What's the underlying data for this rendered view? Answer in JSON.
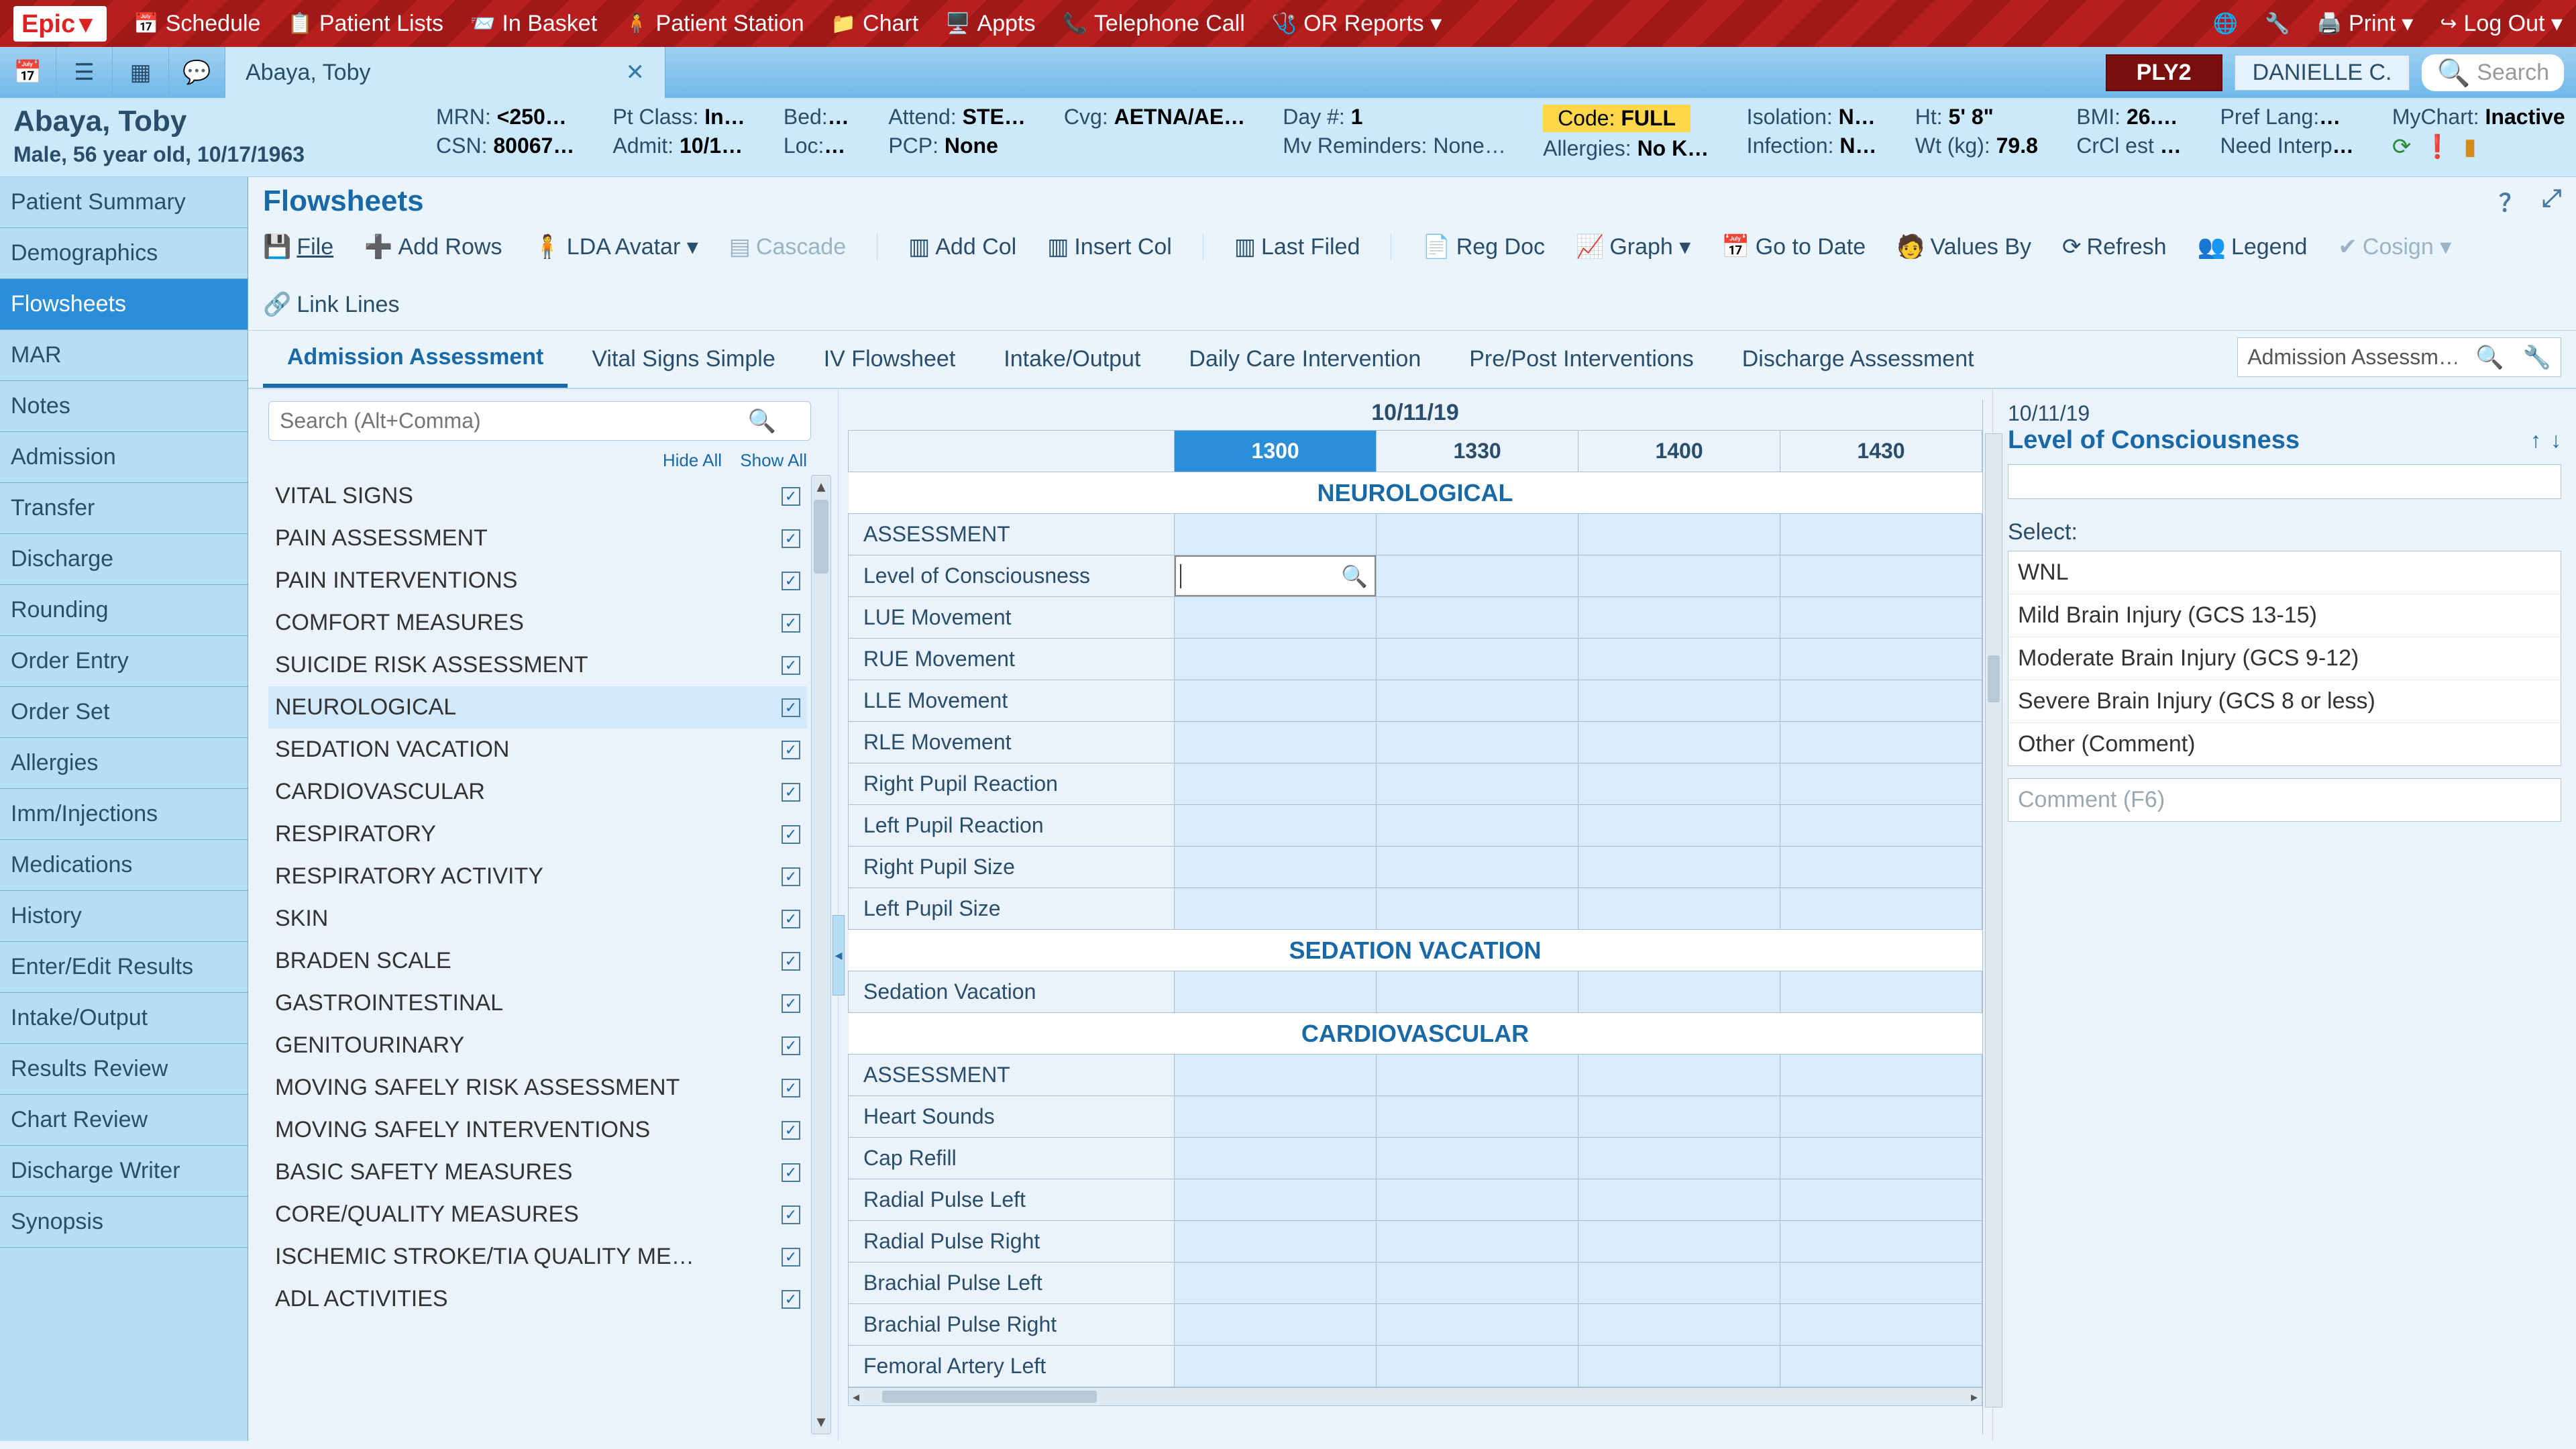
{
  "topbar": {
    "logo": "Epic",
    "items": [
      {
        "icon": "📅",
        "label": "Schedule"
      },
      {
        "icon": "📋",
        "label": "Patient Lists"
      },
      {
        "icon": "📨",
        "label": "In Basket"
      },
      {
        "icon": "🧍",
        "label": "Patient Station"
      },
      {
        "icon": "📁",
        "label": "Chart"
      },
      {
        "icon": "🖥️",
        "label": "Appts"
      },
      {
        "icon": "📞",
        "label": "Telephone Call"
      },
      {
        "icon": "🩺",
        "label": "OR Reports ▾"
      }
    ],
    "print": "Print ▾",
    "logout": "Log Out ▾"
  },
  "tabstrip": {
    "patient_tab": "Abaya, Toby",
    "ply": "PLY2",
    "user": "DANIELLE C.",
    "search_placeholder": "Search"
  },
  "banner": {
    "name": "Abaya, Toby",
    "demo": "Male, 56 year old, 10/17/1963",
    "mrn_l": "MRN:",
    "mrn": "<250…",
    "csn_l": "CSN:",
    "csn": "80067…",
    "ptclass_l": "Pt Class:",
    "ptclass": "In…",
    "admit_l": "Admit:",
    "admit": "10/1…",
    "bed_l": "Bed:",
    "bed": "…",
    "loc_l": "Loc:",
    "loc": "…",
    "attend_l": "Attend:",
    "attend": "STE…",
    "pcp_l": "PCP:",
    "pcp": "None",
    "cvg_l": "Cvg:",
    "cvg": "AETNA/AE…",
    "day_l": "Day #:",
    "day": "1",
    "rem_l": "Mv Reminders:",
    "rem": "None…",
    "code_l": "Code:",
    "code": "FULL",
    "allerg_l": "Allergies:",
    "allerg": "No K…",
    "iso_l": "Isolation:",
    "iso": "N…",
    "inf_l": "Infection:",
    "inf": "N…",
    "ht_l": "Ht:",
    "ht": "5' 8\"",
    "wt_l": "Wt (kg):",
    "wt": "79.8",
    "bmi_l": "BMI:",
    "bmi": "26.…",
    "crcl_l": "CrCl est",
    "crcl": "…",
    "lang_l": "Pref Lang:",
    "lang": "…",
    "interp_l": "Need Interp",
    "interp": "…",
    "mychart_l": "MyChart:",
    "mychart": "Inactive"
  },
  "leftnav": [
    "Patient Summary",
    "Demographics",
    "Flowsheets",
    "MAR",
    "Notes",
    "Admission",
    "Transfer",
    "Discharge",
    "Rounding",
    "Order Entry",
    "Order Set",
    "Allergies",
    "Imm/Injections",
    "Medications",
    "History",
    "Enter/Edit Results",
    "Intake/Output",
    "Results Review",
    "Chart Review",
    "Discharge Writer",
    "Synopsis"
  ],
  "leftnav_active": 2,
  "flowsheet": {
    "title": "Flowsheets",
    "toolbar": {
      "file": "File",
      "addrows": "Add Rows",
      "lda": "LDA Avatar ▾",
      "cascade": "Cascade",
      "addcol": "Add Col",
      "insertcol": "Insert Col",
      "lastfiled": "Last Filed",
      "regdoc": "Reg Doc",
      "graph": "Graph ▾",
      "gotodate": "Go to Date",
      "valuesby": "Values By",
      "refresh": "Refresh",
      "legend": "Legend",
      "cosign": "Cosign ▾",
      "linklines": "Link Lines"
    },
    "tabs": [
      "Admission Assessment",
      "Vital Signs Simple",
      "IV Flowsheet",
      "Intake/Output",
      "Daily Care Intervention",
      "Pre/Post Interventions",
      "Discharge Assessment"
    ],
    "tab_active": 0,
    "picker_value": "Admission Assessm…",
    "rowgroup_search_placeholder": "Search (Alt+Comma)",
    "hide_all": "Hide All",
    "show_all": "Show All",
    "rowgroups": [
      "VITAL SIGNS",
      "PAIN ASSESSMENT",
      "PAIN INTERVENTIONS",
      "COMFORT MEASURES",
      "SUICIDE RISK ASSESSMENT",
      "NEUROLOGICAL",
      "SEDATION VACATION",
      "CARDIOVASCULAR",
      "RESPIRATORY",
      "RESPIRATORY ACTIVITY",
      "SKIN",
      "BRADEN SCALE",
      "GASTROINTESTINAL",
      "GENITOURINARY",
      "MOVING SAFELY RISK ASSESSMENT",
      "MOVING SAFELY INTERVENTIONS",
      "BASIC SAFETY MEASURES",
      "CORE/QUALITY MEASURES",
      "ISCHEMIC STROKE/TIA QUALITY ME…",
      "ADL ACTIVITIES"
    ],
    "rowgroup_selected": 5,
    "grid": {
      "date": "10/11/19",
      "times": [
        "1300",
        "1330",
        "1400",
        "1430"
      ],
      "time_selected": 0,
      "sections": [
        {
          "title": "NEUROLOGICAL",
          "rows": [
            "ASSESSMENT",
            "Level of Consciousness",
            "LUE Movement",
            "RUE Movement",
            "LLE Movement",
            "RLE Movement",
            "Right Pupil Reaction",
            "Left Pupil Reaction",
            "Right Pupil Size",
            "Left Pupil Size"
          ],
          "edit_row": 1
        },
        {
          "title": "SEDATION VACATION",
          "rows": [
            "Sedation Vacation"
          ]
        },
        {
          "title": "CARDIOVASCULAR",
          "rows": [
            "ASSESSMENT",
            "Heart Sounds",
            "Cap Refill",
            "Radial Pulse Left",
            "Radial Pulse Right",
            "Brachial Pulse Left",
            "Brachial Pulse Right",
            "Femoral Artery Left"
          ]
        }
      ]
    },
    "detail": {
      "date": "10/11/19",
      "title": "Level of Consciousness",
      "select_label": "Select:",
      "options": [
        "WNL",
        "Mild Brain Injury (GCS 13-15)",
        "Moderate Brain Injury (GCS 9-12)",
        "Severe Brain Injury (GCS 8 or less)",
        "Other (Comment)"
      ],
      "comment_placeholder": "Comment (F6)"
    }
  }
}
